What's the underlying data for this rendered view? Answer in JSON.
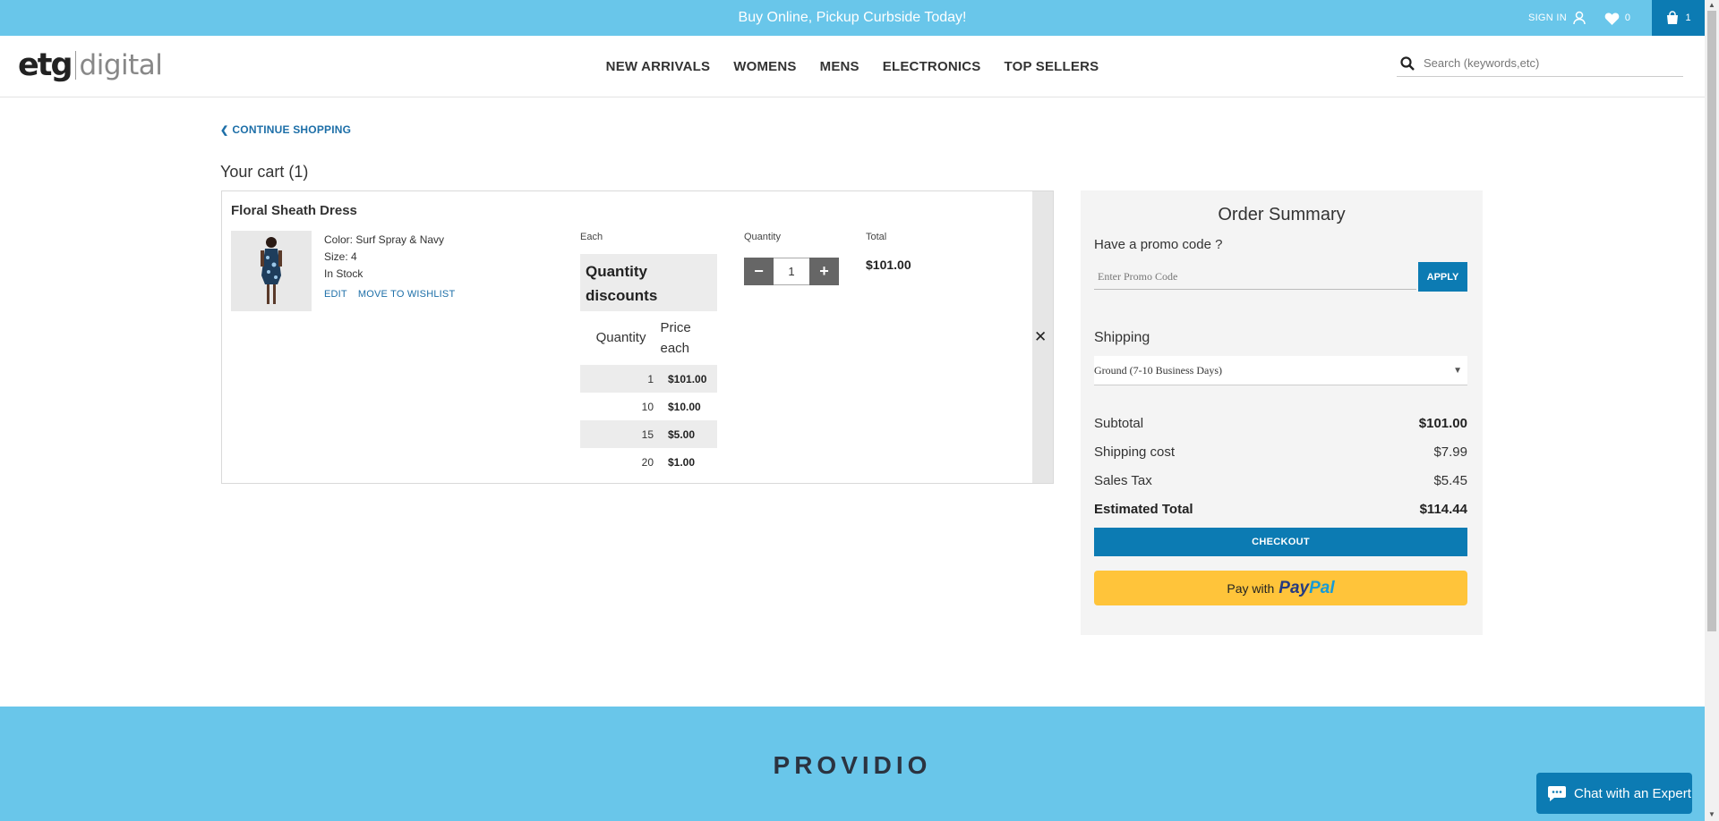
{
  "topbar": {
    "promo": "Buy Online, Pickup Curbside Today!",
    "signin": "SIGN IN",
    "wishlist_count": "0",
    "cart_count": "1"
  },
  "header": {
    "logo_main": "etg",
    "logo_sub": "digital",
    "nav": [
      "NEW ARRIVALS",
      "WOMENS",
      "MENS",
      "ELECTRONICS",
      "TOP SELLERS"
    ],
    "search_placeholder": "Search (keywords,etc)"
  },
  "cart": {
    "continue_label": "CONTINUE SHOPPING",
    "title": "Your cart (1)",
    "item": {
      "name": "Floral Sheath Dress",
      "color": "Color: Surf Spray & Navy",
      "size": "Size: 4",
      "stock": "In Stock",
      "edit": "EDIT",
      "move_wishlist": "MOVE TO WISHLIST",
      "each_label": "Each",
      "quantity_label": "Quantity",
      "total_label": "Total",
      "quantity": "1",
      "total": "$101.00",
      "discounts": {
        "title": "Quantity discounts",
        "col_quantity": "Quantity",
        "col_price": "Price each",
        "rows": [
          {
            "qty": "1",
            "price": "$101.00"
          },
          {
            "qty": "10",
            "price": "$10.00"
          },
          {
            "qty": "15",
            "price": "$5.00"
          },
          {
            "qty": "20",
            "price": "$1.00"
          }
        ]
      }
    }
  },
  "summary": {
    "title": "Order Summary",
    "promo_question": "Have a promo code ?",
    "promo_placeholder": "Enter Promo Code",
    "apply": "APPLY",
    "shipping_label": "Shipping",
    "shipping_selected": "Ground (7-10 Business Days)",
    "subtotal_label": "Subtotal",
    "subtotal": "$101.00",
    "shipping_cost_label": "Shipping cost",
    "shipping_cost": "$7.99",
    "tax_label": "Sales Tax",
    "tax": "$5.45",
    "est_total_label": "Estimated Total",
    "est_total": "$114.44",
    "checkout": "CHECKOUT",
    "paypal_prefix": "Pay with",
    "paypal_brand_1": "Pay",
    "paypal_brand_2": "Pal"
  },
  "footer": {
    "brand": "PROVIDIO"
  },
  "chat": {
    "label": "Chat with an Expert"
  },
  "colors": {
    "topbar": "#69c6ea",
    "accent": "#0c7bb3",
    "paypal": "#ffc43a"
  }
}
